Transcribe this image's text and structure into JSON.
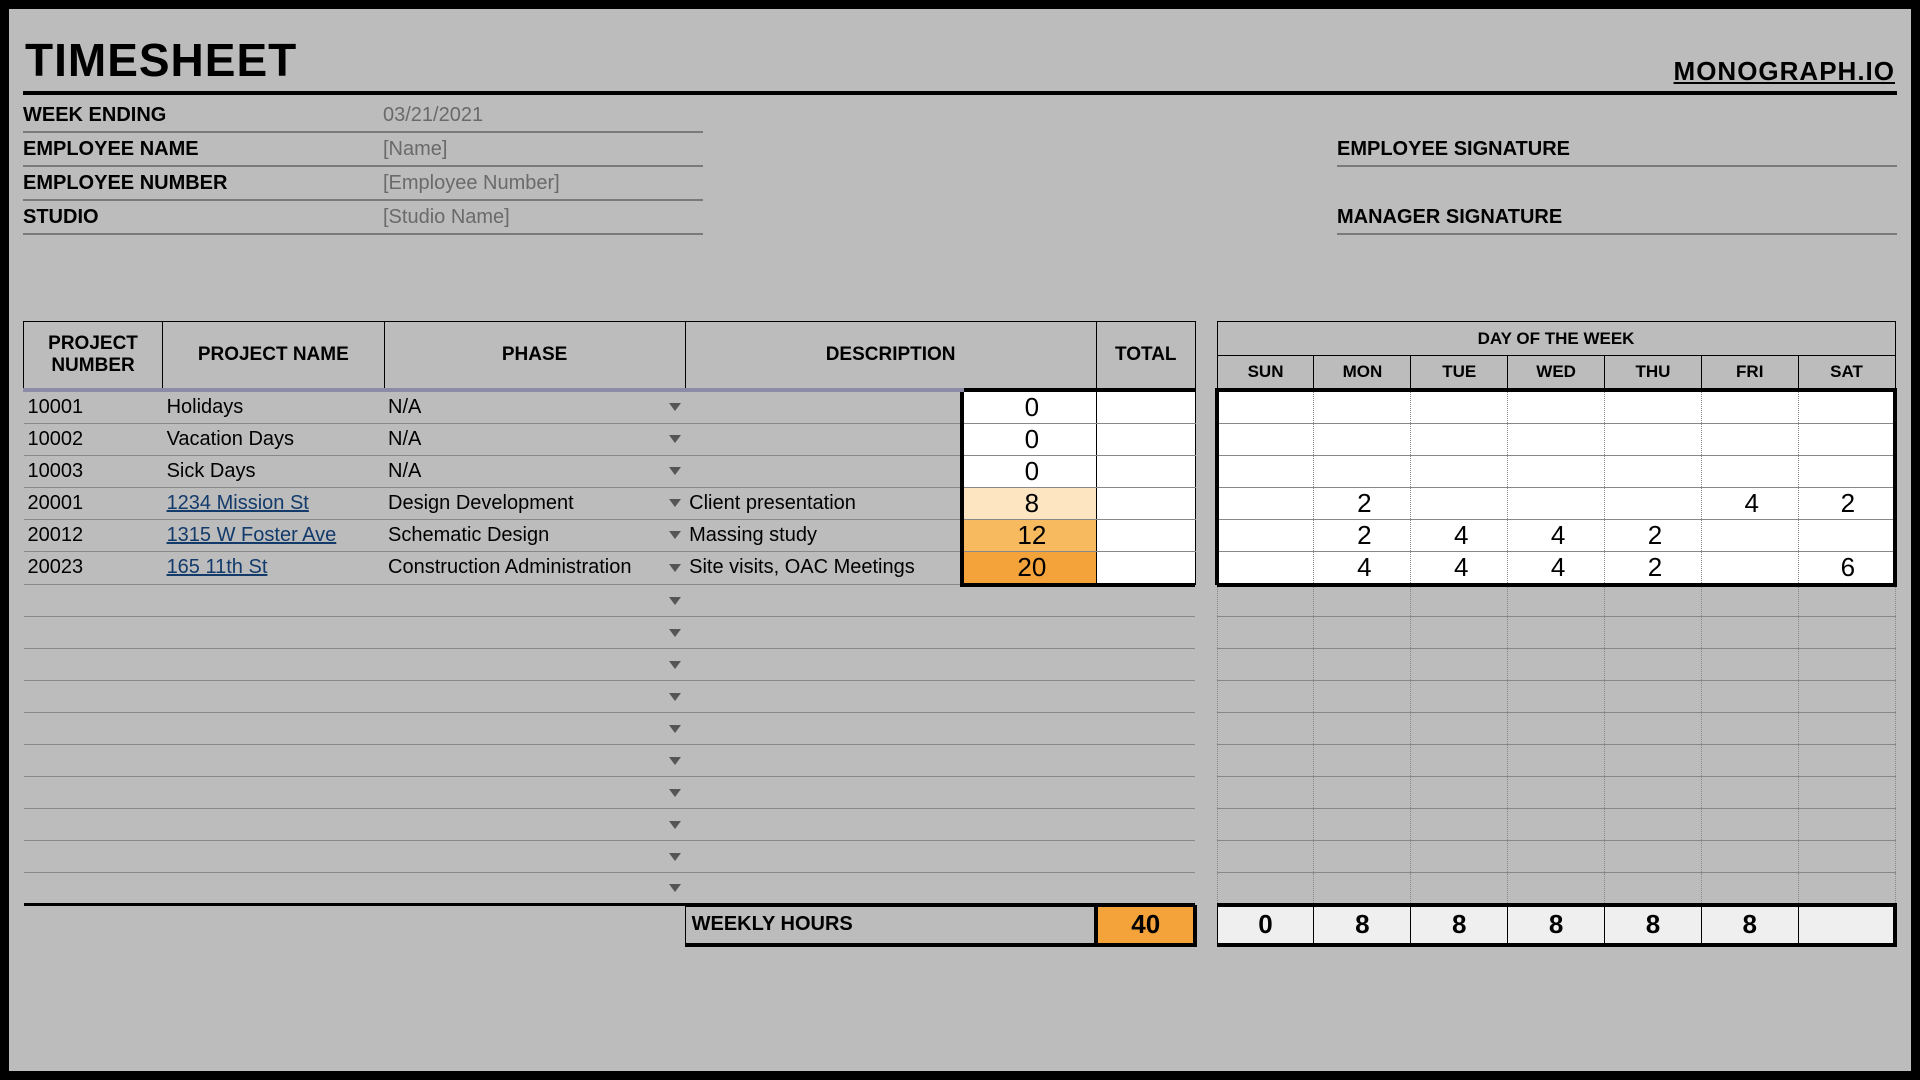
{
  "title": "TIMESHEET",
  "brand": "MONOGRAPH.IO",
  "info": {
    "week_ending_label": "WEEK ENDING",
    "week_ending_value": "03/21/2021",
    "employee_name_label": "EMPLOYEE NAME",
    "employee_name_value": "[Name]",
    "employee_number_label": "EMPLOYEE NUMBER",
    "employee_number_value": "[Employee Number]",
    "studio_label": "STUDIO",
    "studio_value": "[Studio Name]",
    "employee_signature_label": "EMPLOYEE SIGNATURE",
    "manager_signature_label": "MANAGER SIGNATURE"
  },
  "headers": {
    "project_number": "PROJECT NUMBER",
    "project_name": "PROJECT NAME",
    "phase": "PHASE",
    "description": "DESCRIPTION",
    "total": "TOTAL",
    "day_of_week": "DAY OF THE WEEK",
    "days": [
      "SUN",
      "MON",
      "TUE",
      "WED",
      "THU",
      "FRI",
      "SAT"
    ]
  },
  "rows": [
    {
      "num": "10001",
      "name": "Holidays",
      "link": false,
      "phase": "N/A",
      "desc": "",
      "total": "0",
      "days": [
        "",
        "",
        "",
        "",
        "",
        "",
        ""
      ],
      "fill": "none"
    },
    {
      "num": "10002",
      "name": "Vacation Days",
      "link": false,
      "phase": "N/A",
      "desc": "",
      "total": "0",
      "days": [
        "",
        "",
        "",
        "",
        "",
        "",
        ""
      ],
      "fill": "none"
    },
    {
      "num": "10003",
      "name": "Sick Days",
      "link": false,
      "phase": "N/A",
      "desc": "",
      "total": "0",
      "days": [
        "",
        "",
        "",
        "",
        "",
        "",
        ""
      ],
      "fill": "none"
    },
    {
      "num": "20001",
      "name": "1234 Mission St",
      "link": true,
      "phase": "Design Development",
      "desc": "Client presentation",
      "total": "8",
      "days": [
        "",
        "2",
        "",
        "",
        "",
        "4",
        "2"
      ],
      "fill": "light"
    },
    {
      "num": "20012",
      "name": "1315 W Foster Ave",
      "link": true,
      "phase": "Schematic Design",
      "desc": "Massing study",
      "total": "12",
      "days": [
        "",
        "2",
        "4",
        "4",
        "2",
        "",
        ""
      ],
      "fill": "med"
    },
    {
      "num": "20023",
      "name": "165 11th St",
      "link": true,
      "phase": "Construction Administration",
      "desc": "Site visits, OAC Meetings",
      "total": "20",
      "days": [
        "",
        "4",
        "4",
        "4",
        "2",
        "",
        "6"
      ],
      "fill": "dark"
    }
  ],
  "empty_rows": 10,
  "footer": {
    "label": "WEEKLY HOURS",
    "total": "40",
    "days": [
      "0",
      "8",
      "8",
      "8",
      "8",
      "8",
      ""
    ]
  }
}
